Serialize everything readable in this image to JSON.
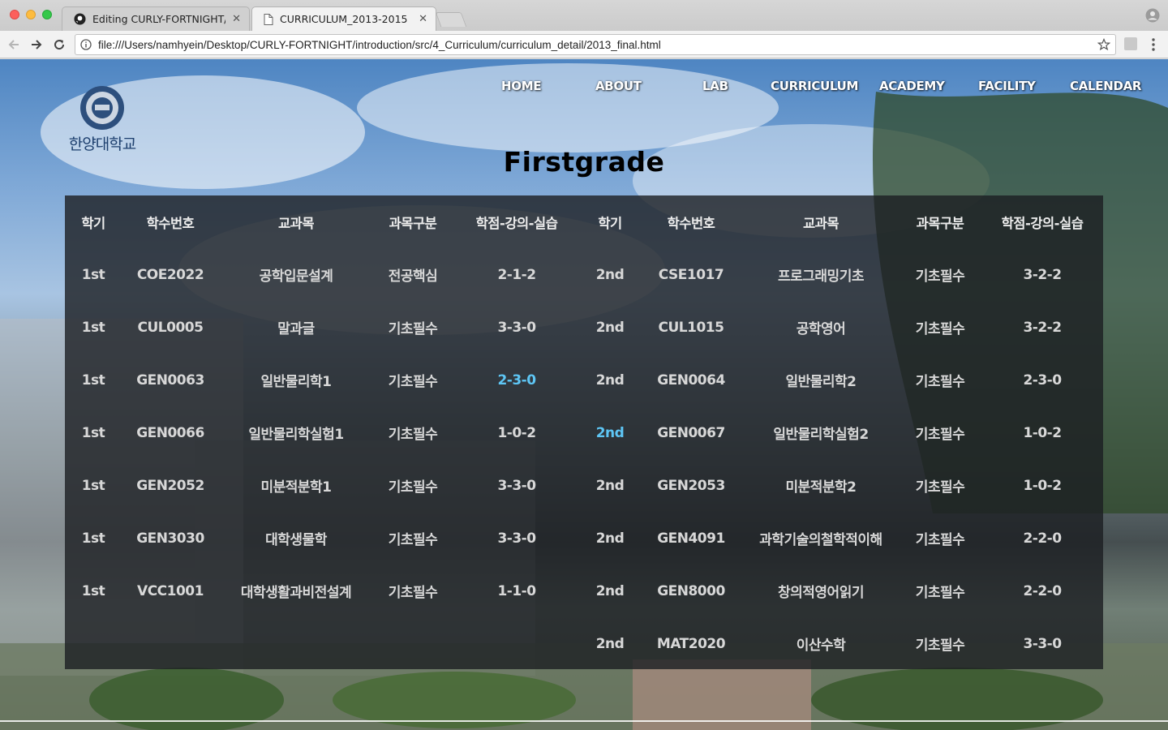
{
  "browser": {
    "tabs": [
      {
        "title": "Editing CURLY-FORTNIGHT/RE",
        "active": false,
        "icon": "github-icon"
      },
      {
        "title": "CURRICULUM_2013-2015",
        "active": true,
        "icon": "document-icon"
      }
    ],
    "url": "file:///Users/namhyein/Desktop/CURLY-FORTNIGHT/introduction/src/4_Curriculum/curriculum_detail/2013_final.html"
  },
  "site": {
    "logo_text": "한양대학교",
    "nav": [
      "HOME",
      "ABOUT",
      "LAB",
      "CURRICULUM",
      "ACADEMY",
      "FACILITY",
      "CALENDAR"
    ],
    "title": "Firstgrade"
  },
  "colors": {
    "panel": "#1c1e22",
    "text": "#d8d8d8",
    "highlight": "#5ec6f5"
  },
  "table": {
    "headers": [
      "학기",
      "학수번호",
      "교과목",
      "과목구분",
      "학점-강의-실습",
      "학기",
      "학수번호",
      "교과목",
      "과목구분",
      "학점-강의-실습"
    ],
    "rows": [
      [
        "1st",
        "COE2022",
        "공학입문설계",
        "전공핵심",
        "2-1-2",
        "2nd",
        "CSE1017",
        "프로그래밍기초",
        "기초필수",
        "3-2-2"
      ],
      [
        "1st",
        "CUL0005",
        "말과글",
        "기초필수",
        "3-3-0",
        "2nd",
        "CUL1015",
        "공학영어",
        "기초필수",
        "3-2-2"
      ],
      [
        "1st",
        "GEN0063",
        "일반물리학1",
        "기초필수",
        "2-3-0",
        "2nd",
        "GEN0064",
        "일반물리학2",
        "기초필수",
        "2-3-0"
      ],
      [
        "1st",
        "GEN0066",
        "일반물리학실험1",
        "기초필수",
        "1-0-2",
        "2nd",
        "GEN0067",
        "일반물리학실험2",
        "기초필수",
        "1-0-2"
      ],
      [
        "1st",
        "GEN2052",
        "미분적분학1",
        "기초필수",
        "3-3-0",
        "2nd",
        "GEN2053",
        "미분적분학2",
        "기초필수",
        "1-0-2"
      ],
      [
        "1st",
        "GEN3030",
        "대학생물학",
        "기초필수",
        "3-3-0",
        "2nd",
        "GEN4091",
        "과학기술의철학적이해",
        "기초필수",
        "2-2-0"
      ],
      [
        "1st",
        "VCC1001",
        "대학생활과비전설계",
        "기초필수",
        "1-1-0",
        "2nd",
        "GEN8000",
        "창의적영어읽기",
        "기초필수",
        "2-2-0"
      ],
      [
        "",
        "",
        "",
        "",
        "",
        "2nd",
        "MAT2020",
        "이산수학",
        "기초필수",
        "3-3-0"
      ]
    ],
    "highlighted_cells": [
      [
        2,
        4
      ],
      [
        3,
        5
      ]
    ]
  }
}
